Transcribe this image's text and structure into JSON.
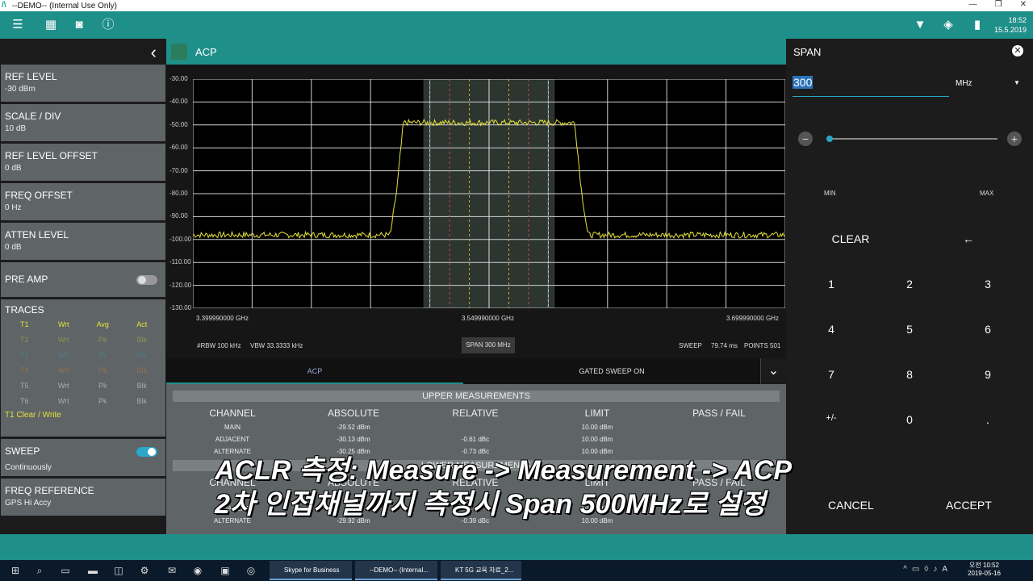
{
  "window": {
    "title": "--DEMO-- (Internal Use Only)"
  },
  "appbar": {
    "time": "18:52",
    "date": "15.5.2019",
    "battery": "98%"
  },
  "left": {
    "items": [
      {
        "label": "REF LEVEL",
        "value": "-30 dBm"
      },
      {
        "label": "SCALE / DIV",
        "value": "10 dB"
      },
      {
        "label": "REF LEVEL OFFSET",
        "value": "0 dB"
      },
      {
        "label": "FREQ OFFSET",
        "value": "0 Hz"
      },
      {
        "label": "ATTEN LEVEL",
        "value": "0 dB"
      }
    ],
    "preamp": {
      "label": "PRE AMP",
      "on": false
    },
    "traces": {
      "label": "TRACES",
      "headers": [
        "T1",
        "Wrt",
        "Avg",
        "Act"
      ],
      "rows": [
        [
          "T2",
          "Wrt",
          "Pk",
          "Blk"
        ],
        [
          "T3",
          "Wrt",
          "Pk",
          "Blk"
        ],
        [
          "T4",
          "Wrt",
          "Pk",
          "Blk"
        ],
        [
          "T5",
          "Wrt",
          "Pk",
          "Blk"
        ],
        [
          "T6",
          "Wrt",
          "Pk",
          "Blk"
        ]
      ],
      "footer": "T1 Clear / Write",
      "colors": [
        "#e6e13a",
        "#2aa7c9",
        "#e88a2a",
        "#aaaaaa",
        "#aaaaaa"
      ]
    },
    "sweep": {
      "label": "SWEEP",
      "value": "Continuously",
      "on": true
    },
    "freq_ref": {
      "label": "FREQ REFERENCE",
      "value": "GPS Hi Accy"
    }
  },
  "center": {
    "title": "ACP",
    "y_ticks": [
      "-30.00",
      "-40.00",
      "-50.00",
      "-60.00",
      "-70.00",
      "-80.00",
      "-90.00",
      "-100.00",
      "-110.00",
      "-120.00",
      "-130.00"
    ],
    "x_left": "3.399990000 GHz",
    "x_center": "3.549990000 GHz",
    "x_right": "3.699990000 GHz",
    "rbw": "#RBW 100 kHz",
    "vbw": "VBW 33.3333 kHz",
    "span_button": "SPAN 300 MHz",
    "sweep": "SWEEP",
    "sweep_time": "79.74 ms",
    "points": "POINTS 501",
    "tabs": [
      "ACP",
      "GATED SWEEP ON"
    ],
    "upper": {
      "title": "UPPER MEASUREMENTS",
      "headers": [
        "CHANNEL",
        "ABSOLUTE",
        "RELATIVE",
        "LIMIT",
        "PASS / FAIL"
      ],
      "rows": [
        [
          "MAIN",
          "-29.52 dBm",
          "",
          "10.00 dBm",
          ""
        ],
        [
          "ADJACENT",
          "-30.13 dBm",
          "-0.61 dBc",
          "10.00 dBm",
          ""
        ],
        [
          "ALTERNATE",
          "-30.25 dBm",
          "-0.73 dBc",
          "10.00 dBm",
          ""
        ]
      ]
    },
    "lower": {
      "title": "LOWER MEASUREMENTS",
      "headers": [
        "CHANNEL",
        "ABSOLUTE",
        "RELATIVE",
        "LIMIT",
        "PASS / FAIL"
      ],
      "rows": [
        [
          "ADJACENT",
          "",
          "",
          "10.00 dBm",
          ""
        ],
        [
          "ALTERNATE",
          "-29.92 dBm",
          "-0.39 dBc",
          "10.00 dBm",
          ""
        ]
      ]
    }
  },
  "chart_data": {
    "type": "line",
    "ylim": [
      -130,
      -30
    ],
    "xlim": [
      3.39999,
      3.69999
    ],
    "x_unit": "GHz",
    "y_unit": "dBm",
    "series": [
      {
        "x": [
          3.39999,
          3.5,
          3.5033,
          3.5066,
          3.5934,
          3.5967,
          3.6,
          3.69999
        ],
        "values": [
          -98,
          -98,
          -78,
          -49,
          -49,
          -78,
          -98,
          -98
        ]
      }
    ],
    "channel_lines": [
      3.52,
      3.53,
      3.54,
      3.54999,
      3.56,
      3.57,
      3.58
    ],
    "grid": true,
    "trace_color": "#e6e13a"
  },
  "right": {
    "title": "SPAN",
    "value": "300",
    "unit": "MHz",
    "min": "MIN",
    "max": "MAX",
    "clear": "CLEAR",
    "backspace": "←",
    "keys": [
      "1",
      "2",
      "3",
      "4",
      "5",
      "6",
      "7",
      "8",
      "9",
      "+/-",
      "0",
      "."
    ],
    "cancel": "CANCEL",
    "accept": "ACCEPT",
    "slider_level": 0
  },
  "subtitle": {
    "line1": "ACLR 측정: Measure -> Measurement -> ACP",
    "line2": "2차 인접채널까지 측정시 Span 500MHz로 설정"
  },
  "taskbar": {
    "apps": [
      "Skype for Business",
      "--DEMO-- (Internal...",
      "KT 5G 교육 자료_2..."
    ],
    "time": "오전 10:52",
    "date": "2019-05-16"
  }
}
